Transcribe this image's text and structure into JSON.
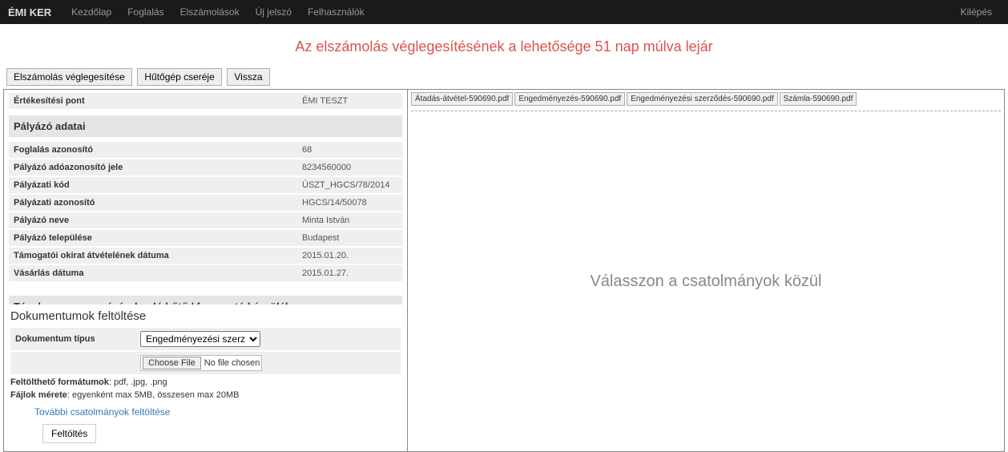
{
  "nav": {
    "brand": "ÉMI KER",
    "items": [
      "Kezdőlap",
      "Foglalás",
      "Elszámolások",
      "Új jelszó",
      "Felhasználók"
    ],
    "logout": "Kilépés"
  },
  "alert": "Az elszámolás véglegesítésének a lehetősége 51 nap múlva lejár",
  "actions": {
    "finalize": "Elszámolás véglegesítése",
    "swap": "Hűtőgép cseréje",
    "back": "Vissza"
  },
  "fields": {
    "pos_label": "Értékesítési pont",
    "pos_val": "ÉMI TESZT",
    "applicant_head": "Pályázó adatai",
    "booking_id_label": "Foglalás azonosító",
    "booking_id_val": "68",
    "tax_label": "Pályázó adóazonosító jele",
    "tax_val": "8234560000",
    "tender_code_label": "Pályázati kód",
    "tender_code_val": "ÚSZT_HGCS/78/2014",
    "tender_id_label": "Pályázati azonosító",
    "tender_id_val": "HGCS/14/50078",
    "name_label": "Pályázó neve",
    "name_val": "Minta István",
    "city_label": "Pályázó települése",
    "city_val": "Budapest",
    "grant_date_label": "Támogatói okirat átvételének dátuma",
    "grant_date_val": "2015.01.20.",
    "purchase_date_label": "Vásárlás dátuma",
    "purchase_date_val": "2015.01.27.",
    "device_head": "Ténylegesen megvásárolandó hűtő / fagyasztó készülék"
  },
  "upload": {
    "title": "Dokumentumok feltöltése",
    "type_label": "Dokumentum típus",
    "type_selected": "Engedményezési szerződés",
    "choose": "Choose File",
    "no_file": "No file chosen",
    "formats_label": "Feltölthető formátumok",
    "formats_val": ": pdf, .jpg, .png",
    "size_label": "Fájlok mérete",
    "size_val": ": egyenként max 5MB, összesen max 20MB",
    "more_link": "További csatolmányok feltöltése",
    "submit": "Feltöltés"
  },
  "tabs": [
    "Átadás-átvétel-590690.pdf",
    "Engedményezés-590690.pdf",
    "Engedményezési szerződés-590690.pdf",
    "Számla-590690.pdf"
  ],
  "preview_placeholder": "Válasszon a csatolmányok közül"
}
